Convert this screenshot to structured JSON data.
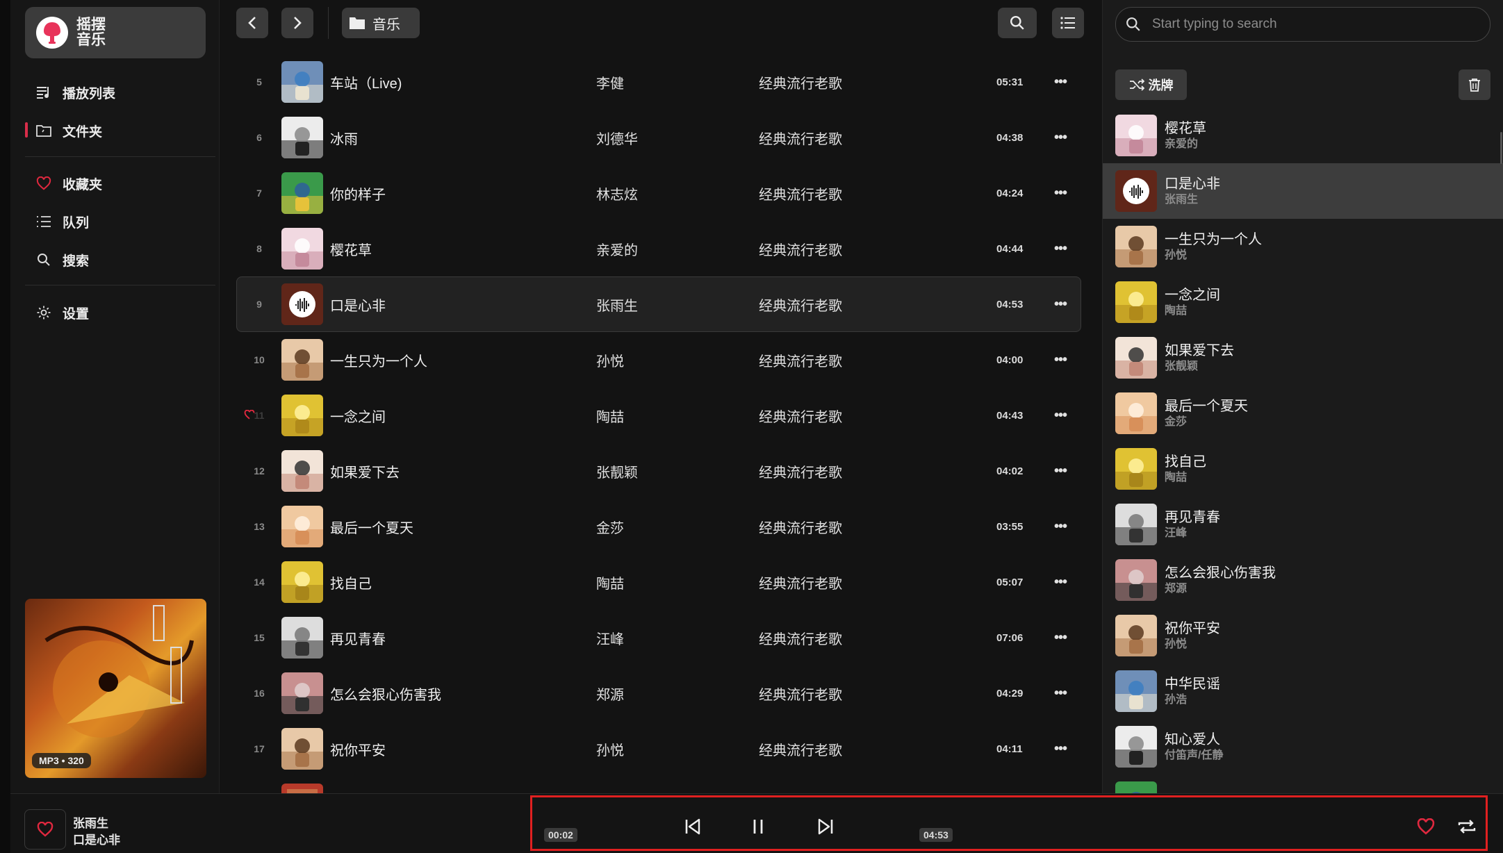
{
  "app": {
    "name_line1": "摇摆",
    "name_line2": "音乐",
    "accent": "#d82d4a",
    "logo_color": "#e8335a"
  },
  "sidebar": {
    "items": [
      {
        "label": "播放列表",
        "icon": "playlist-icon"
      },
      {
        "label": "文件夹",
        "icon": "folder-icon",
        "active": true
      },
      {
        "label": "收藏夹",
        "icon": "heart-icon"
      },
      {
        "label": "队列",
        "icon": "queue-icon"
      },
      {
        "label": "搜索",
        "icon": "search-icon"
      },
      {
        "label": "设置",
        "icon": "gear-icon"
      }
    ],
    "art_badge": "MP3 • 320"
  },
  "main": {
    "breadcrumb": "音乐",
    "tracks": [
      {
        "num": "5",
        "title": "车站（Live)",
        "artist": "李健",
        "album": "经典流行老歌",
        "duration": "05:31"
      },
      {
        "num": "6",
        "title": "冰雨",
        "artist": "刘德华",
        "album": "经典流行老歌",
        "duration": "04:38"
      },
      {
        "num": "7",
        "title": "你的样子",
        "artist": "林志炫",
        "album": "经典流行老歌",
        "duration": "04:24"
      },
      {
        "num": "8",
        "title": "樱花草",
        "artist": "亲爱的",
        "album": "经典流行老歌",
        "duration": "04:44"
      },
      {
        "num": "9",
        "title": "口是心非",
        "artist": "张雨生",
        "album": "经典流行老歌",
        "duration": "04:53",
        "active": true
      },
      {
        "num": "10",
        "title": "一生只为一个人",
        "artist": "孙悦",
        "album": "经典流行老歌",
        "duration": "04:00"
      },
      {
        "num": "11",
        "title": "一念之间",
        "artist": "陶喆",
        "album": "经典流行老歌",
        "duration": "04:43",
        "favorite": true
      },
      {
        "num": "12",
        "title": "如果爱下去",
        "artist": "张靓颖",
        "album": "经典流行老歌",
        "duration": "04:02"
      },
      {
        "num": "13",
        "title": "最后一个夏天",
        "artist": "金莎",
        "album": "经典流行老歌",
        "duration": "03:55"
      },
      {
        "num": "14",
        "title": "找自己",
        "artist": "陶喆",
        "album": "经典流行老歌",
        "duration": "05:07"
      },
      {
        "num": "15",
        "title": "再见青春",
        "artist": "汪峰",
        "album": "经典流行老歌",
        "duration": "07:06"
      },
      {
        "num": "16",
        "title": "怎么会狠心伤害我",
        "artist": "郑源",
        "album": "经典流行老歌",
        "duration": "04:29"
      },
      {
        "num": "17",
        "title": "祝你平安",
        "artist": "孙悦",
        "album": "经典流行老歌",
        "duration": "04:11"
      }
    ],
    "more_label": "•••"
  },
  "queue": {
    "search_placeholder": "Start typing to search",
    "shuffle_label": "洗牌",
    "items": [
      {
        "title": "樱花草",
        "artist": "亲爱的"
      },
      {
        "title": "口是心非",
        "artist": "张雨生",
        "active": true
      },
      {
        "title": "一生只为一个人",
        "artist": "孙悦"
      },
      {
        "title": "一念之间",
        "artist": "陶喆"
      },
      {
        "title": "如果爱下去",
        "artist": "张靓颖"
      },
      {
        "title": "最后一个夏天",
        "artist": "金莎"
      },
      {
        "title": "找自己",
        "artist": "陶喆"
      },
      {
        "title": "再见青春",
        "artist": "汪峰"
      },
      {
        "title": "怎么会狠心伤害我",
        "artist": "郑源"
      },
      {
        "title": "祝你平安",
        "artist": "孙悦"
      },
      {
        "title": "中华民谣",
        "artist": "孙浩"
      },
      {
        "title": "知心爱人",
        "artist": "付笛声/任静"
      },
      {
        "title": "",
        "artist": ""
      }
    ]
  },
  "player": {
    "artist": "张雨生",
    "title": "口是心非",
    "elapsed": "00:02",
    "total": "04:53",
    "heart_color": "#e0283f"
  }
}
